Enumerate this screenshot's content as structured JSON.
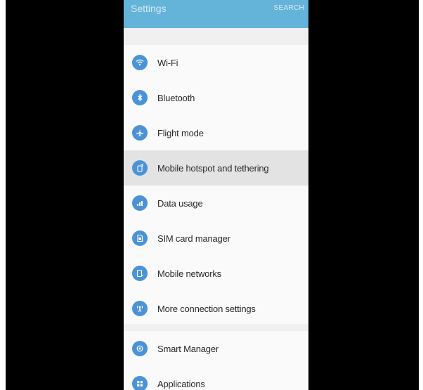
{
  "app_bar": {
    "title": "Settings",
    "search_label": "SEARCH"
  },
  "connections": [
    {
      "label": "Wi-Fi",
      "icon": "wifi-icon"
    },
    {
      "label": "Bluetooth",
      "icon": "bluetooth-icon"
    },
    {
      "label": "Flight mode",
      "icon": "airplane-icon"
    },
    {
      "label": "Mobile hotspot and tethering",
      "icon": "hotspot-icon",
      "selected": true
    },
    {
      "label": "Data usage",
      "icon": "data-usage-icon"
    },
    {
      "label": "SIM card manager",
      "icon": "sim-card-icon"
    },
    {
      "label": "Mobile networks",
      "icon": "mobile-networks-icon"
    },
    {
      "label": "More connection settings",
      "icon": "more-connections-icon"
    }
  ],
  "system": [
    {
      "label": "Smart Manager",
      "icon": "smart-manager-icon"
    },
    {
      "label": "Applications",
      "icon": "applications-icon"
    }
  ],
  "colors": {
    "app_bar": "#64b3d8",
    "icon": "#4b93d6",
    "highlight": "#e3e3e3",
    "frame": "#000000"
  }
}
